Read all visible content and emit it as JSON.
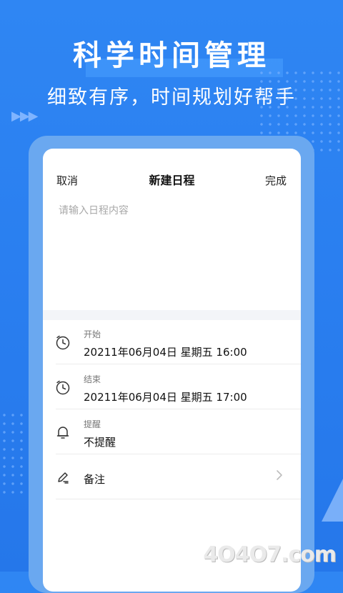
{
  "hero": {
    "title": "科学时间管理",
    "subtitle": "细致有序，时间规划好帮手",
    "arrows": "▶▶▶"
  },
  "topbar": {
    "cancel_label": "取消",
    "title": "新建日程",
    "done_label": "完成"
  },
  "content": {
    "placeholder": "请输入日程内容",
    "value": ""
  },
  "rows": {
    "start": {
      "label": "开始",
      "value": "20211年06月04日   星期五  16:00",
      "icon": "clock-icon"
    },
    "end": {
      "label": "结束",
      "value": "20211年06月04日   星期五  17:00",
      "icon": "clock-icon"
    },
    "reminder": {
      "label": "提醒",
      "value": "不提醒",
      "icon": "bell-icon"
    },
    "notes": {
      "label": "备注",
      "icon": "pen-icon"
    }
  },
  "watermark": "4O4O7.com",
  "colors": {
    "background": "#2a7ff0",
    "frame": "#6aa8f0",
    "card": "#ffffff",
    "separator": "#f3f5f8"
  }
}
